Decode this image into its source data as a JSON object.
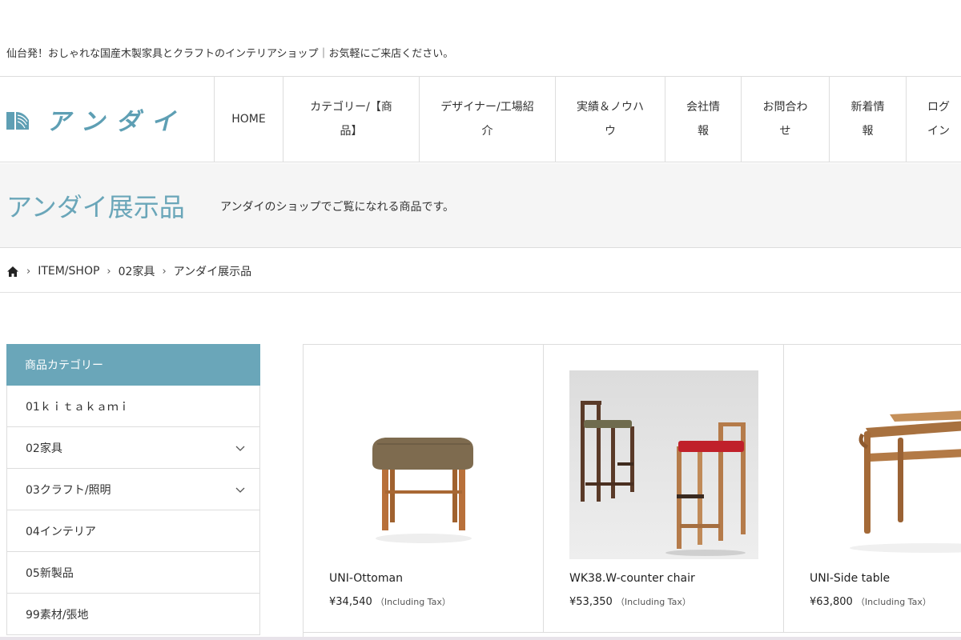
{
  "site": {
    "tagline": "仙台発！おしゃれな国産木製家具とクラフトのインテリアショップ｜お気軽にご来店ください。",
    "logo_text": "アンダイ",
    "brand_color": "#6aa6b9"
  },
  "nav": [
    {
      "label": "HOME"
    },
    {
      "label": "カテゴリー/【商品】"
    },
    {
      "label": "デザイナー/工場紹介"
    },
    {
      "label": "実績＆ノウハウ"
    },
    {
      "label": "会社情報"
    },
    {
      "label": "お問合わせ"
    },
    {
      "label": "新着情報"
    },
    {
      "label": "ログイン"
    }
  ],
  "hero": {
    "title": "アンダイ展示品",
    "description": "アンダイのショップでご覧になれる商品です。"
  },
  "breadcrumb": {
    "home_icon": "home-icon",
    "items": [
      "ITEM/SHOP",
      "02家具",
      "アンダイ展示品"
    ]
  },
  "sidebar": {
    "heading": "商品カテゴリー",
    "items": [
      {
        "label": "01ｋｉｔａｋａｍｉ",
        "expandable": false
      },
      {
        "label": "02家具",
        "expandable": true
      },
      {
        "label": "03クラフト/照明",
        "expandable": true
      },
      {
        "label": "04インテリア",
        "expandable": false
      },
      {
        "label": "05新製品",
        "expandable": false
      },
      {
        "label": "99素材/張地",
        "expandable": false
      }
    ]
  },
  "products": [
    {
      "name": "UNI-Ottoman",
      "price": "¥34,540",
      "tax": "（Including Tax）"
    },
    {
      "name": "WK38.W-counter chair",
      "price": "¥53,350",
      "tax": "（Including Tax）"
    },
    {
      "name": "UNI-Side table",
      "price": "¥63,800",
      "tax": "（Including Tax）"
    }
  ]
}
